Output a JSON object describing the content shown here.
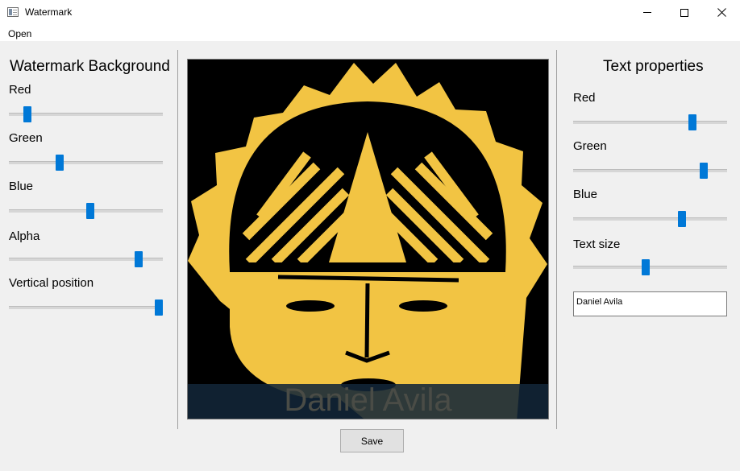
{
  "window": {
    "title": "Watermark"
  },
  "menu": {
    "items": [
      "Open"
    ]
  },
  "watermark_background": {
    "title": "Watermark Background",
    "sliders": [
      {
        "label": "Red",
        "value": 0.1
      },
      {
        "label": "Green",
        "value": 0.32
      },
      {
        "label": "Blue",
        "value": 0.53
      },
      {
        "label": "Alpha",
        "value": 0.86
      },
      {
        "label": "Vertical position",
        "value": 1.0
      }
    ]
  },
  "text_properties": {
    "title": "Text properties",
    "sliders": [
      {
        "label": "Red",
        "value": 0.79
      },
      {
        "label": "Green",
        "value": 0.87
      },
      {
        "label": "Blue",
        "value": 0.72
      },
      {
        "label": "Text size",
        "value": 0.47
      }
    ],
    "text_value": "Daniel Avila"
  },
  "preview": {
    "watermark_text": "Daniel Avila",
    "mask_color": "#f2c443",
    "background_color": "#000000",
    "band_color": "#122638"
  },
  "actions": {
    "save_label": "Save"
  },
  "colors": {
    "slider_handle": "#0078d7",
    "window_bg": "#f0f0f0"
  }
}
